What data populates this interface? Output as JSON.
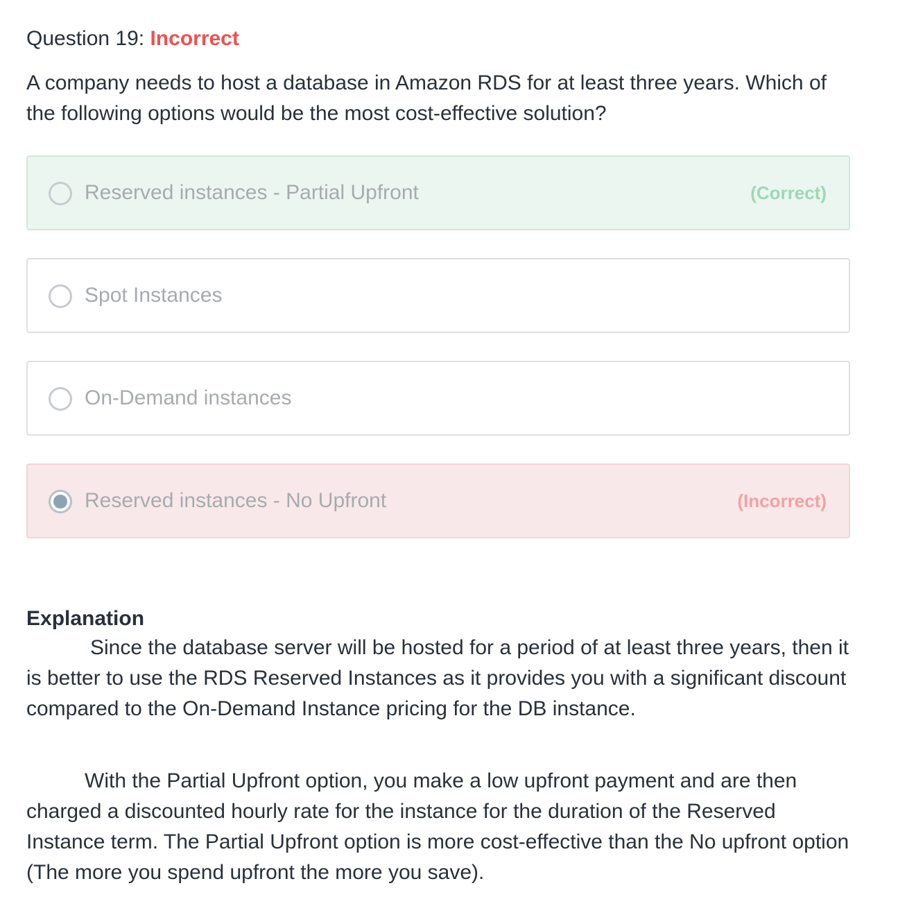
{
  "question": {
    "number_label": "Question 19:",
    "status": "Incorrect",
    "text": "A company needs to host a database in Amazon RDS for at least three years. Which of the following options would be the most cost-effective solution?"
  },
  "options": [
    {
      "label": "Reserved instances - Partial Upfront",
      "state": "correct",
      "tag": "(Correct)",
      "selected": false
    },
    {
      "label": "Spot Instances",
      "state": "neutral",
      "tag": "",
      "selected": false
    },
    {
      "label": "On-Demand instances",
      "state": "neutral",
      "tag": "",
      "selected": false
    },
    {
      "label": "Reserved instances - No Upfront",
      "state": "incorrect",
      "tag": "(Incorrect)",
      "selected": true
    }
  ],
  "explanation": {
    "title": "Explanation",
    "paragraphs": [
      "Since the database server will be hosted for a period of at least three years, then it is better to use the RDS Reserved Instances as it provides you with a significant discount compared to the On-Demand Instance pricing for the DB instance.",
      "With the Partial Upfront option, you make a low upfront payment and are then charged a discounted hourly rate for the instance for the duration of the Reserved Instance term. The Partial Upfront option is more cost-effective than the No upfront option (The more you spend upfront the more you save)."
    ]
  },
  "colors": {
    "incorrect_status": "#ec5252",
    "correct_bg": "#ebf6f0",
    "incorrect_bg": "#f8e8e9",
    "correct_tag": "#9fd7b6",
    "incorrect_tag": "#f0a3a3"
  },
  "icons": {
    "radio": "radio-button-icon"
  }
}
